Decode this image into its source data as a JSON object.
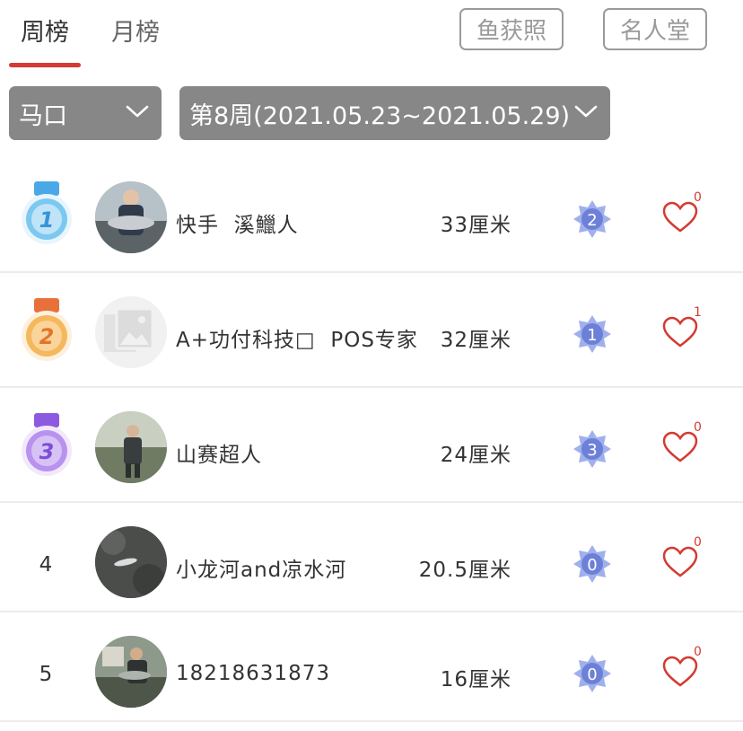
{
  "tabs": {
    "week": "周榜",
    "month": "月榜"
  },
  "buttons": {
    "catch_photos": "鱼获照",
    "hall_of_fame": "名人堂"
  },
  "filters": {
    "place": "马口",
    "week": "第8周(2021.05.23~2021.05.29)"
  },
  "colors": {
    "accent": "#d33b33",
    "dropdown_bg": "#878787",
    "badge": "#7d8fe0"
  },
  "rows": [
    {
      "rank": "1",
      "medal": "gold-blue",
      "name": "快手  溪鱲人",
      "length": "33厘米",
      "badge": "2",
      "likes": "0"
    },
    {
      "rank": "2",
      "medal": "bronze",
      "name": "A+功付科技□  POS专家",
      "length": "32厘米",
      "badge": "1",
      "likes": "1"
    },
    {
      "rank": "3",
      "medal": "purple",
      "name": "山赛超人",
      "length": "24厘米",
      "badge": "3",
      "likes": "0"
    },
    {
      "rank": "4",
      "medal": "",
      "name": "小龙河and凉水河",
      "length": "20.5厘米",
      "badge": "0",
      "likes": "0"
    },
    {
      "rank": "5",
      "medal": "",
      "name": "18218631873",
      "length": "16厘米",
      "badge": "0",
      "likes": "0"
    }
  ]
}
